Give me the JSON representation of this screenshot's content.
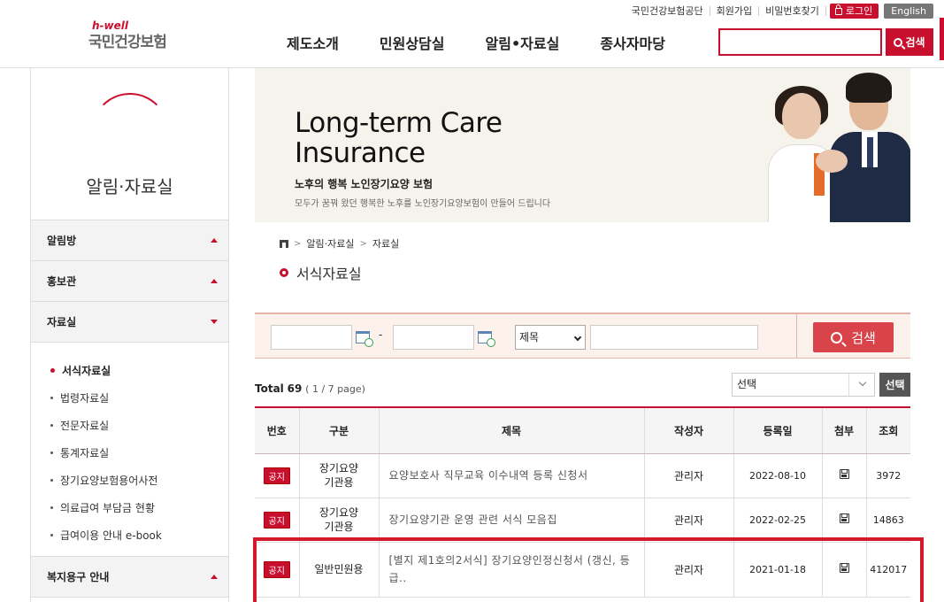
{
  "header": {
    "logo_sub": "h-well",
    "logo_main": "국민건강보험",
    "util_links": [
      "국민건강보험공단",
      "회원가입",
      "비밀번호찾기"
    ],
    "login_label": "로그인",
    "english_label": "English",
    "gnb": [
      "제도소개",
      "민원상담실",
      "알림•자료실",
      "종사자마당"
    ],
    "search_value": "",
    "search_button": "검색"
  },
  "sidebar": {
    "title": "알림·자료실",
    "menu": [
      {
        "label": "알림방",
        "state": "collapsed"
      },
      {
        "label": "홍보관",
        "state": "collapsed"
      },
      {
        "label": "자료실",
        "state": "expanded"
      }
    ],
    "sub_items": [
      "서식자료실",
      "법령자료실",
      "전문자료실",
      "통계자료실",
      "장기요양보험용어사전",
      "의료급여 부담금 현황",
      "급여이용 안내 e-book"
    ],
    "active_sub": "서식자료실",
    "menu_after": {
      "label": "복지용구 안내"
    }
  },
  "banner": {
    "heading_line1": "Long-term Care",
    "heading_line2": "Insurance",
    "subheading": "노후의 행복 노인장기요양 보험",
    "description": "모두가 꿈꿔 왔던 행복한 노후를 노인장기요양보험이 만들어 드립니다"
  },
  "breadcrumb": [
    "알림·자료실",
    "자료실"
  ],
  "page_title": "서식자료실",
  "search_panel": {
    "date_from": "",
    "date_to": "",
    "dash": "-",
    "field_select": "제목",
    "keyword": "",
    "button": "검색"
  },
  "list": {
    "total_label": "Total",
    "total": "69",
    "page_info": "( 1 / 7 page)",
    "filter_value": "선택",
    "filter_button": "선택"
  },
  "table": {
    "headers": [
      "번호",
      "구분",
      "제목",
      "작성자",
      "등록일",
      "첨부",
      "조회"
    ],
    "rows": [
      {
        "badge": "공지",
        "category": "장기요양\n기관용",
        "title": "요양보호사 직무교육 이수내역 등록 신청서",
        "author": "관리자",
        "date": "2022-08-10",
        "views": "3972"
      },
      {
        "badge": "공지",
        "category": "장기요양\n기관용",
        "title": "장기요양기관 운영 관련 서식 모음집",
        "author": "관리자",
        "date": "2022-02-25",
        "views": "14863"
      },
      {
        "badge": "공지",
        "category": "일반민원용",
        "title": "[별지 제1호의2서식] 장기요양인정신청서 (갱신, 등급..",
        "author": "관리자",
        "date": "2021-01-18",
        "views": "412017"
      }
    ]
  },
  "colors": {
    "brand": "#c8102e",
    "search_btn": "#d9444a",
    "panel_bg": "#fdf1ec"
  }
}
